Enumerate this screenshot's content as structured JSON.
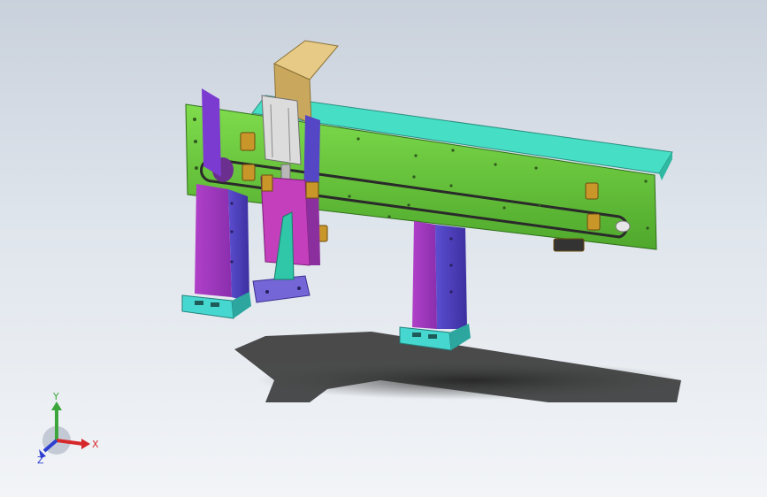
{
  "viewport": {
    "background_top": "#c9d1dc",
    "background_bottom": "#f2f4f7"
  },
  "model": {
    "colors": {
      "rail_plate": "#6fcf3f",
      "rail_top": "#45e0c4",
      "legs": "#8e3fc0",
      "legs_dark": "#6a2c99",
      "legs_blue": "#5b4fc8",
      "base_plates": "#3fd8d0",
      "carriage": "#c83fb8",
      "cylinder_block": "#e0c88a",
      "cylinder_body": "#d8d8d8",
      "sensors": "#b88a2a",
      "belt": "#3a3a3a",
      "shadow": "#2b2b2b"
    }
  },
  "triad": {
    "x_label": "X",
    "y_label": "Y",
    "z_label": "Z",
    "x_color": "#d6282b",
    "y_color": "#3ca53c",
    "z_color": "#2d3fd0"
  }
}
